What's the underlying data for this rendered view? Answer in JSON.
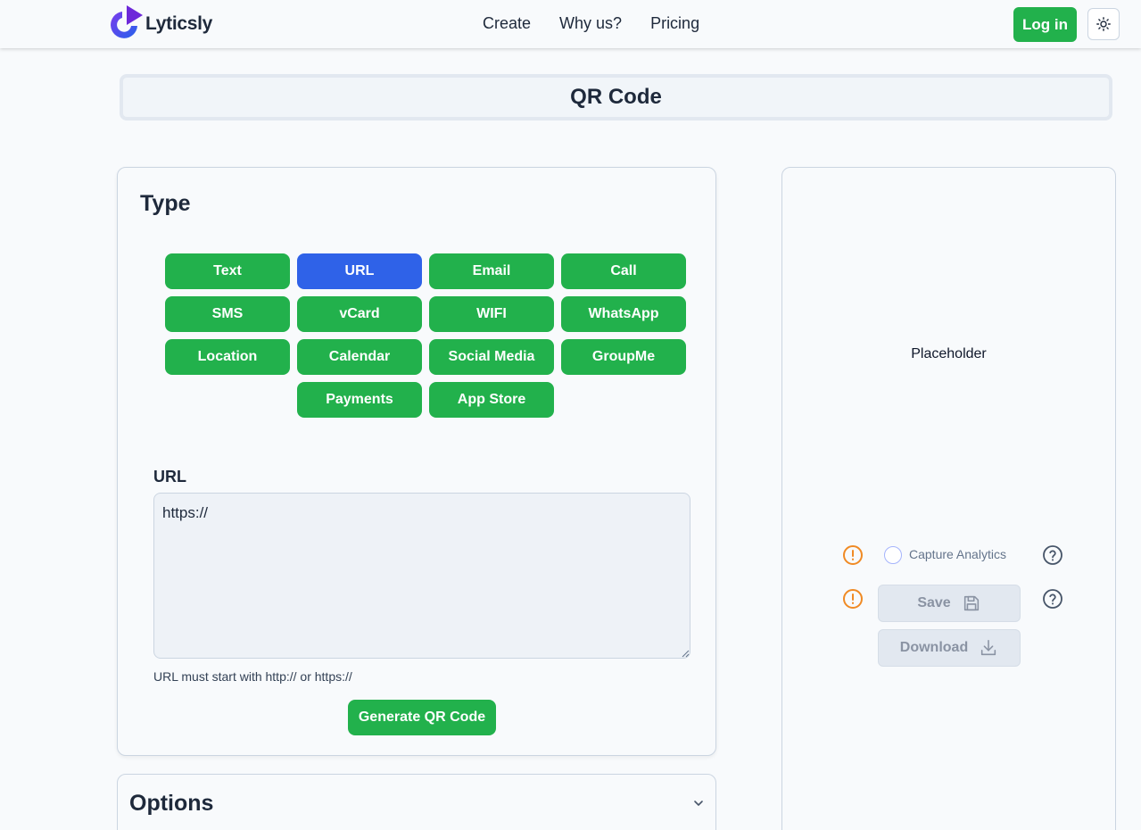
{
  "brand": {
    "name": "Lyticsly",
    "logo_icon": "lyticsly-logo-icon"
  },
  "nav": {
    "links": [
      "Create",
      "Why us?",
      "Pricing"
    ],
    "login_label": "Log in",
    "theme_icon": "sun-icon"
  },
  "page": {
    "title": "QR Code"
  },
  "type_card": {
    "heading": "Type",
    "types": [
      "Text",
      "URL",
      "Email",
      "Call",
      "SMS",
      "vCard",
      "WIFI",
      "WhatsApp",
      "Location",
      "Calendar",
      "Social Media",
      "GroupMe",
      "Payments",
      "App Store"
    ],
    "selected": "URL"
  },
  "url_field": {
    "label": "URL",
    "value": "https://",
    "hint": "URL must start with http:// or https://"
  },
  "generate_label": "Generate QR Code",
  "options": {
    "title": "Options",
    "icon": "chevron-down-icon"
  },
  "preview": {
    "placeholder": "Placeholder",
    "capture_label": "Capture Analytics",
    "save_label": "Save",
    "download_label": "Download"
  },
  "colors": {
    "green": "#22b14c",
    "blue": "#2f62e8",
    "warning": "#f08a24"
  }
}
